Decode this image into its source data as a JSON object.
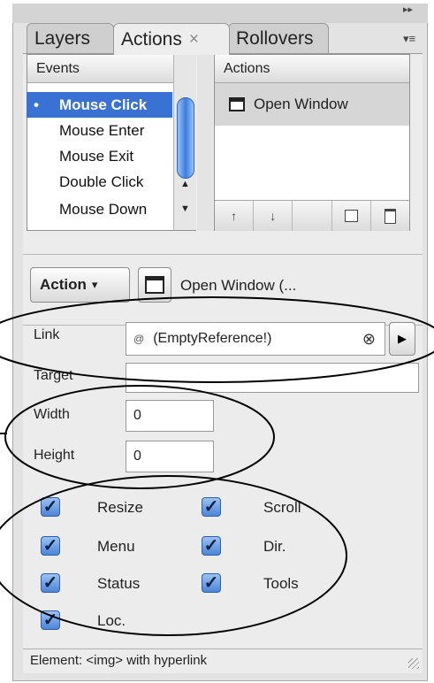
{
  "panel": {
    "menu_glyph": "▸▸",
    "options_glyph": "▾≡",
    "tabs": [
      {
        "label": "Layers"
      },
      {
        "label": "Actions",
        "close": "×"
      },
      {
        "label": "Rollovers"
      }
    ]
  },
  "events": {
    "header": "Events",
    "items": [
      {
        "label": "Mouse Click",
        "selected": true
      },
      {
        "label": "Mouse Enter"
      },
      {
        "label": "Mouse Exit"
      },
      {
        "label": "Double Click"
      },
      {
        "label": "Mouse Down"
      }
    ]
  },
  "actions_list": {
    "header": "Actions",
    "items": [
      {
        "label": "Open Window",
        "icon": "window-icon"
      }
    ],
    "toolbar": {
      "up": "↑",
      "down": "↓",
      "new": "new-action-icon",
      "delete": "trash-icon"
    }
  },
  "action_bar": {
    "action_button": "Action",
    "action_caret": "▾",
    "current_action": "Open Window (..."
  },
  "params": {
    "link_label": "Link",
    "link_value": "(EmptyReference!)",
    "link_symbol": "@",
    "target_label": "Target",
    "target_value": "",
    "width_label": "Width",
    "width_value": "0",
    "height_label": "Height",
    "height_value": "0"
  },
  "options": [
    {
      "label": "Resize",
      "checked": true
    },
    {
      "label": "Scroll",
      "checked": true
    },
    {
      "label": "Menu",
      "checked": true
    },
    {
      "label": "Dir.",
      "checked": true
    },
    {
      "label": "Status",
      "checked": true
    },
    {
      "label": "Tools",
      "checked": true
    },
    {
      "label": "Loc.",
      "checked": true
    }
  ],
  "status_bar": "Element: <img> with hyperlink",
  "colors": {
    "selection": "#3a72d4",
    "checkbox": "#4b86d8",
    "panel": "#ececec"
  }
}
